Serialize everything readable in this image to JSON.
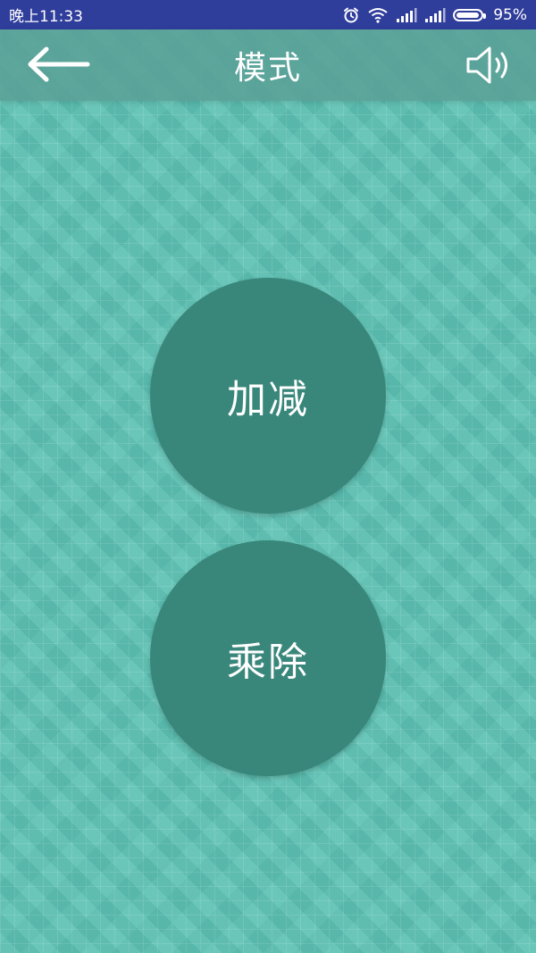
{
  "status_bar": {
    "time": "晚上11:33",
    "battery_percent": "95%",
    "battery_level": 0.95
  },
  "header": {
    "title": "模式",
    "back_icon": "arrow-left-icon",
    "sound_icon": "speaker-icon"
  },
  "modes": [
    {
      "label": "加减"
    },
    {
      "label": "乘除"
    }
  ],
  "colors": {
    "status_bar": "#2f3d9b",
    "background": "#5cc1b3",
    "app_bar": "#5aa096",
    "circle": "#39877b",
    "text": "#ffffff"
  }
}
